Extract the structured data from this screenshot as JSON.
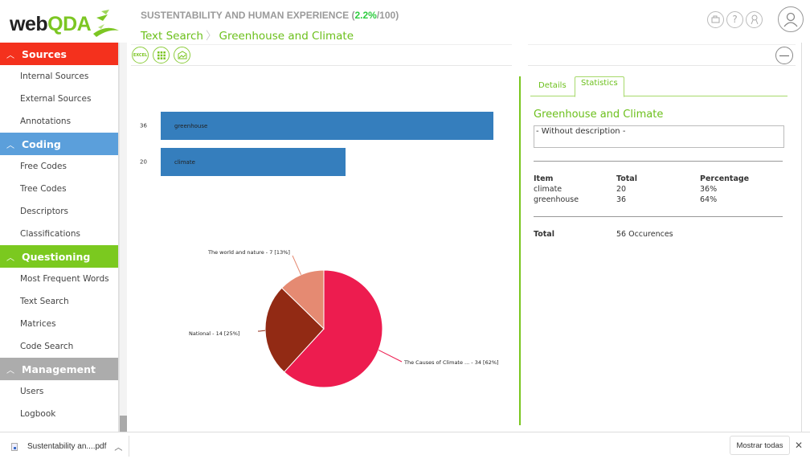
{
  "logo": {
    "web": "web",
    "qda": "QDA"
  },
  "header": {
    "project_name": "SUSTENTABILITY AND HUMAN EXPERIENCE",
    "progress_open": " (",
    "progress_pct": "2.2%",
    "progress_total": "/100)",
    "breadcrumb": [
      "Text Search",
      "Greenhouse and Climate"
    ],
    "breadcrumb_sep": "〉",
    "icons": [
      "media-icon",
      "help-icon",
      "certificate-icon",
      "user-icon"
    ]
  },
  "sidebar": {
    "sections": [
      {
        "label": "Sources",
        "color": "#f4311d",
        "items": [
          "Internal Sources",
          "External Sources",
          "Annotations"
        ]
      },
      {
        "label": "Coding",
        "color": "#5b9fdb",
        "items": [
          "Free Codes",
          "Tree Codes",
          "Descriptors",
          "Classifications"
        ]
      },
      {
        "label": "Questioning",
        "color": "#7bc91f",
        "items": [
          "Most Frequent Words",
          "Text Search",
          "Matrices",
          "Code Search"
        ]
      },
      {
        "label": "Management",
        "color": "#acacac",
        "items": [
          "Users",
          "Logbook"
        ]
      }
    ]
  },
  "toolbar": {
    "excel_label": "EXCEL",
    "buttons": [
      "excel-export",
      "grid-view",
      "image-export"
    ]
  },
  "chart_data": [
    {
      "type": "bar",
      "orientation": "horizontal",
      "categories": [
        "greenhouse",
        "climate"
      ],
      "values": [
        36,
        20
      ],
      "color": "#357ebd",
      "xlim": [
        0,
        36
      ]
    },
    {
      "type": "pie",
      "labels": [
        "The Causes of Climate ...",
        "National",
        "The world and nature"
      ],
      "values": [
        34,
        14,
        7
      ],
      "percentages": [
        62,
        25,
        13
      ],
      "label_texts": [
        "The Causes of Climate ... - 34 [62%]",
        "National - 14 [25%]",
        "The world and nature - 7 [13%]"
      ],
      "colors": [
        "#ed1c4f",
        "#922a14",
        "#e58a72"
      ]
    }
  ],
  "details": {
    "tabs": [
      "Details",
      "Statistics"
    ],
    "active_tab": "Statistics",
    "title": "Greenhouse and Climate",
    "description": "- Without description -",
    "table": {
      "headers": [
        "Item",
        "Total",
        "Percentage"
      ],
      "rows": [
        [
          "climate",
          "20",
          "36%"
        ],
        [
          "greenhouse",
          "36",
          "64%"
        ]
      ]
    },
    "total_label": "Total",
    "total_value": "56 Occurences"
  },
  "downloads": {
    "file_name": "Sustentability an....pdf",
    "show_all": "Mostrar todas"
  }
}
